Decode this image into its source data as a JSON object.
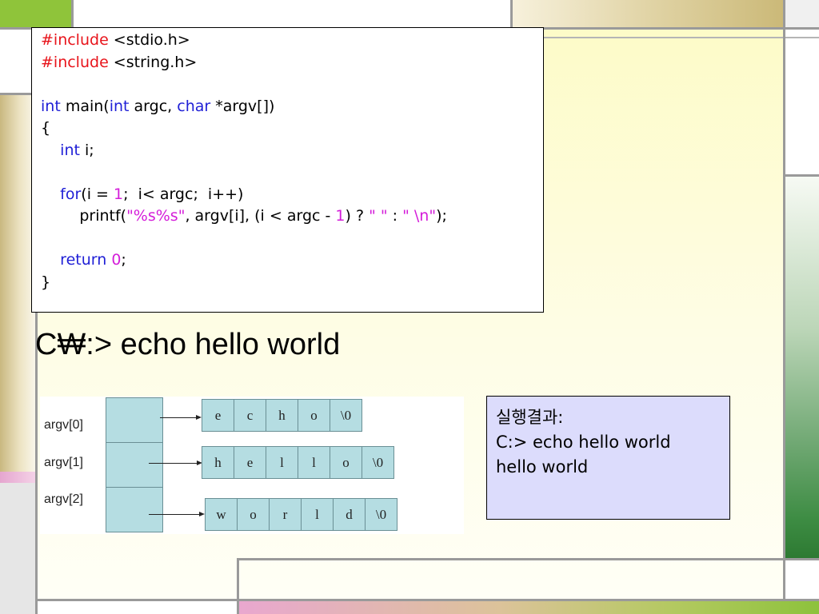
{
  "code": {
    "lines": [
      [
        {
          "t": "#include",
          "c": "red"
        },
        {
          "t": " <stdio.h>"
        }
      ],
      [
        {
          "t": "#include",
          "c": "red"
        },
        {
          "t": " <string.h>"
        }
      ],
      [],
      [
        {
          "t": "int",
          "c": "blue"
        },
        {
          "t": " main("
        },
        {
          "t": "int",
          "c": "blue"
        },
        {
          "t": " argc, "
        },
        {
          "t": "char",
          "c": "blue"
        },
        {
          "t": " *argv[])"
        }
      ],
      [
        {
          "t": "{"
        }
      ],
      [
        {
          "t": "    "
        },
        {
          "t": "int",
          "c": "blue"
        },
        {
          "t": " i;"
        }
      ],
      [],
      [
        {
          "t": "    "
        },
        {
          "t": "for",
          "c": "blue"
        },
        {
          "t": "(i = "
        },
        {
          "t": "1",
          "c": "mag"
        },
        {
          "t": ";  i< argc;  i++)"
        }
      ],
      [
        {
          "t": "        printf("
        },
        {
          "t": "\"%s%s\"",
          "c": "mag"
        },
        {
          "t": ", argv[i], (i < argc - "
        },
        {
          "t": "1",
          "c": "mag"
        },
        {
          "t": ") ? "
        },
        {
          "t": "\" \"",
          "c": "mag"
        },
        {
          "t": " : "
        },
        {
          "t": "\" \\n\"",
          "c": "mag"
        },
        {
          "t": ");"
        }
      ],
      [],
      [
        {
          "t": "    "
        },
        {
          "t": "return",
          "c": "blue"
        },
        {
          "t": " "
        },
        {
          "t": "0",
          "c": "mag"
        },
        {
          "t": ";"
        }
      ],
      [
        {
          "t": "}"
        }
      ]
    ]
  },
  "command_line": "C₩:> echo hello world",
  "diagram": {
    "argv_labels": [
      "argv[0]",
      "argv[1]",
      "argv[2]"
    ],
    "strings": [
      [
        "e",
        "c",
        "h",
        "o",
        "\\0"
      ],
      [
        "h",
        "e",
        "l",
        "l",
        "o",
        "\\0"
      ],
      [
        "w",
        "o",
        "r",
        "l",
        "d",
        "\\0"
      ]
    ]
  },
  "result": {
    "heading": "실행결과:",
    "lines": [
      "C:> echo hello world",
      "hello world"
    ]
  },
  "colors": {
    "keyword_red": "#e8141b",
    "keyword_blue": "#1f1fd6",
    "literal_magenta": "#d41dd9",
    "cell_fill": "#b5dde2",
    "result_bg": "#dcdcfc"
  }
}
